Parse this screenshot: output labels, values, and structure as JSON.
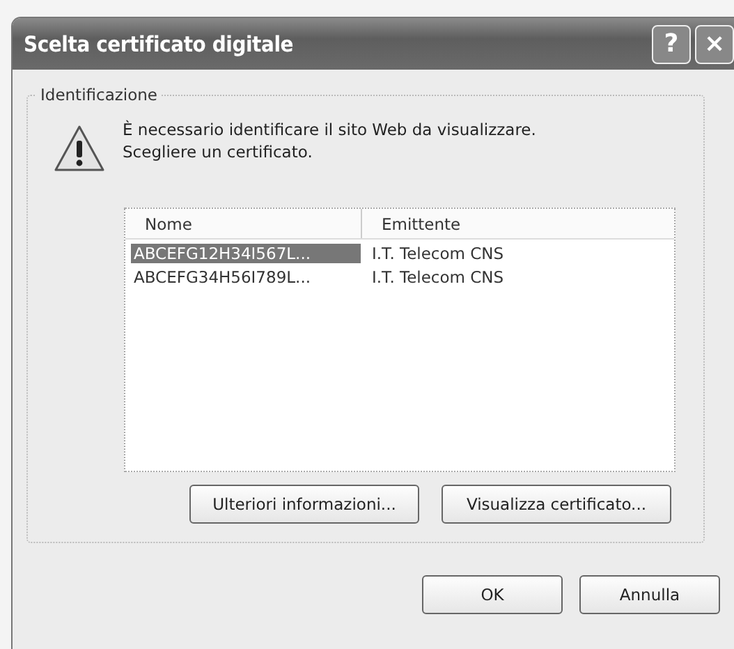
{
  "window": {
    "title": "Scelta certificato digitale",
    "title_buttons": [
      "?",
      "×"
    ]
  },
  "group": {
    "label": "Identificazione",
    "message": [
      "È necessario identificare il sito Web da visualizzare.",
      "Scegliere un certificato."
    ]
  },
  "list": {
    "columns": [
      "Nome",
      "Emittente"
    ],
    "rows": [
      {
        "cells": [
          "ABCEFG12H34I567L...",
          "I.T. Telecom CNS"
        ],
        "selected": true
      },
      {
        "cells": [
          "ABCEFG34H56I789L...",
          "I.T. Telecom CNS"
        ],
        "selected": false
      }
    ]
  },
  "group_buttons": [
    "Ulteriori informazioni...",
    "Visualizza certificato..."
  ],
  "buttons": [
    "OK",
    "Annulla"
  ]
}
